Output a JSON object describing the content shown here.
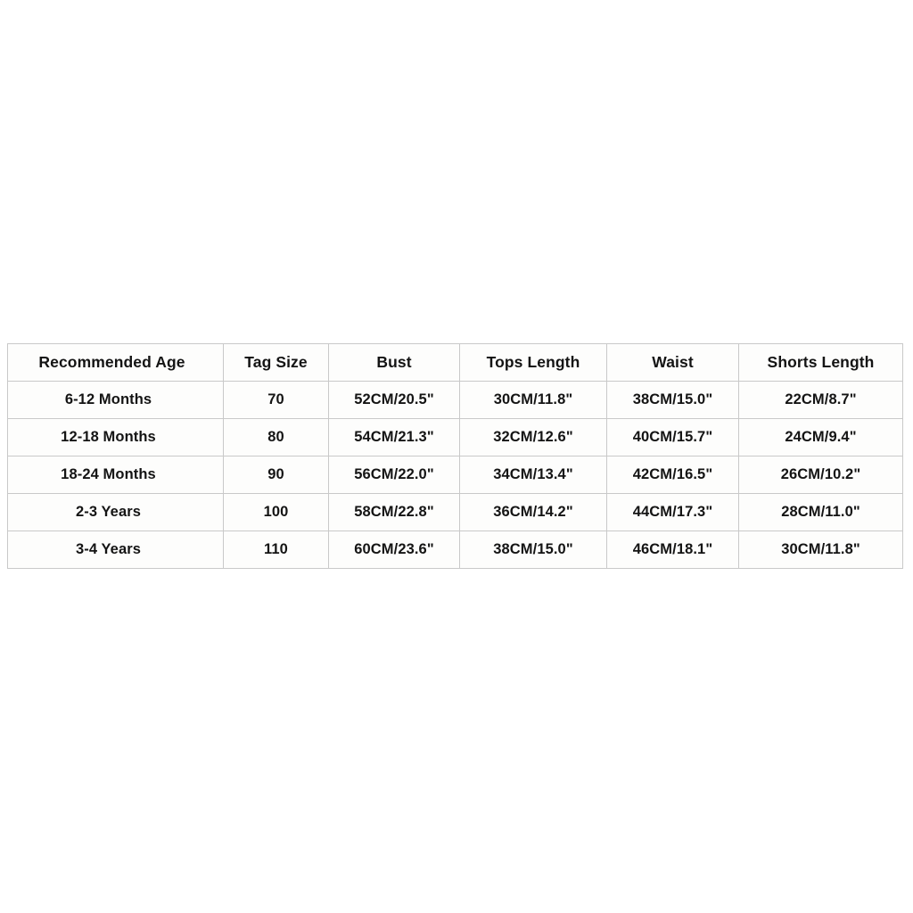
{
  "chart_data": {
    "type": "table",
    "title": "",
    "columns": [
      "Recommended Age",
      "Tag Size",
      "Bust",
      "Tops Length",
      "Waist",
      "Shorts Length"
    ],
    "rows": [
      [
        "6-12 Months",
        "70",
        "52CM/20.5\"",
        "30CM/11.8\"",
        "38CM/15.0\"",
        "22CM/8.7\""
      ],
      [
        "12-18 Months",
        "80",
        "54CM/21.3\"",
        "32CM/12.6\"",
        "40CM/15.7\"",
        "24CM/9.4\""
      ],
      [
        "18-24 Months",
        "90",
        "56CM/22.0\"",
        "34CM/13.4\"",
        "42CM/16.5\"",
        "26CM/10.2\""
      ],
      [
        "2-3 Years",
        "100",
        "58CM/22.8\"",
        "36CM/14.2\"",
        "44CM/17.3\"",
        "28CM/11.0\""
      ],
      [
        "3-4 Years",
        "110",
        "60CM/23.6\"",
        "38CM/15.0\"",
        "46CM/18.1\"",
        "30CM/11.8\""
      ]
    ]
  },
  "colors": {
    "page_background": "#ffffff",
    "cell_background": "#fdfdfc",
    "border": "#c9c9c9",
    "text": "#141414"
  }
}
